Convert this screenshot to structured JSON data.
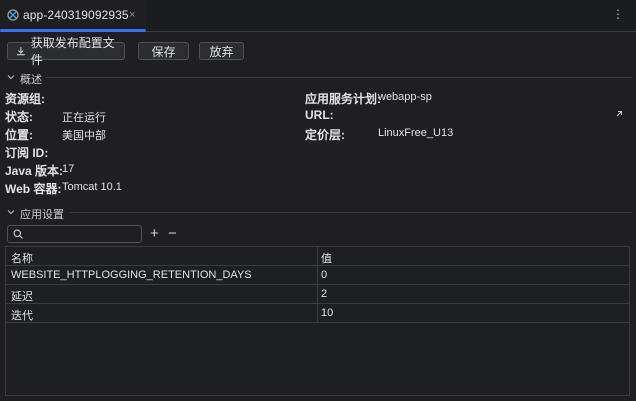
{
  "tab": {
    "title": "app-240319092935",
    "close_glyph": "×",
    "icon": "app-service-icon",
    "accent": "#3574f0"
  },
  "menu_glyph": "⋮",
  "toolbar": {
    "download_label": "获取发布配置文件",
    "save_label": "保存",
    "discard_label": "放弃"
  },
  "overview": {
    "title": "概述",
    "resource_group_label": "资源组:",
    "resource_group_value": "",
    "status_label": "状态:",
    "status_value": "正在运行",
    "location_label": "位置:",
    "location_value": "美国中部",
    "subscription_label": "订阅 ID:",
    "subscription_value": "",
    "java_label": "Java 版本:",
    "java_value": "17",
    "web_container_label": "Web 容器:",
    "web_container_value": "Tomcat 10.1",
    "plan_label": "应用服务计划:",
    "plan_value": "webapp-sp",
    "url_label": "URL:",
    "url_value": "",
    "pricing_label": "定价层:",
    "pricing_value": "LinuxFree_U13"
  },
  "settings": {
    "title": "应用设置",
    "search_placeholder": "",
    "add_glyph": "+",
    "remove_glyph": "−",
    "columns": [
      "名称",
      "值"
    ],
    "rows": [
      {
        "name": "WEBSITE_HTTPLOGGING_RETENTION_DAYS",
        "value": "0"
      },
      {
        "name": "延迟",
        "value": "2"
      },
      {
        "name": "迭代",
        "value": "10"
      }
    ]
  }
}
